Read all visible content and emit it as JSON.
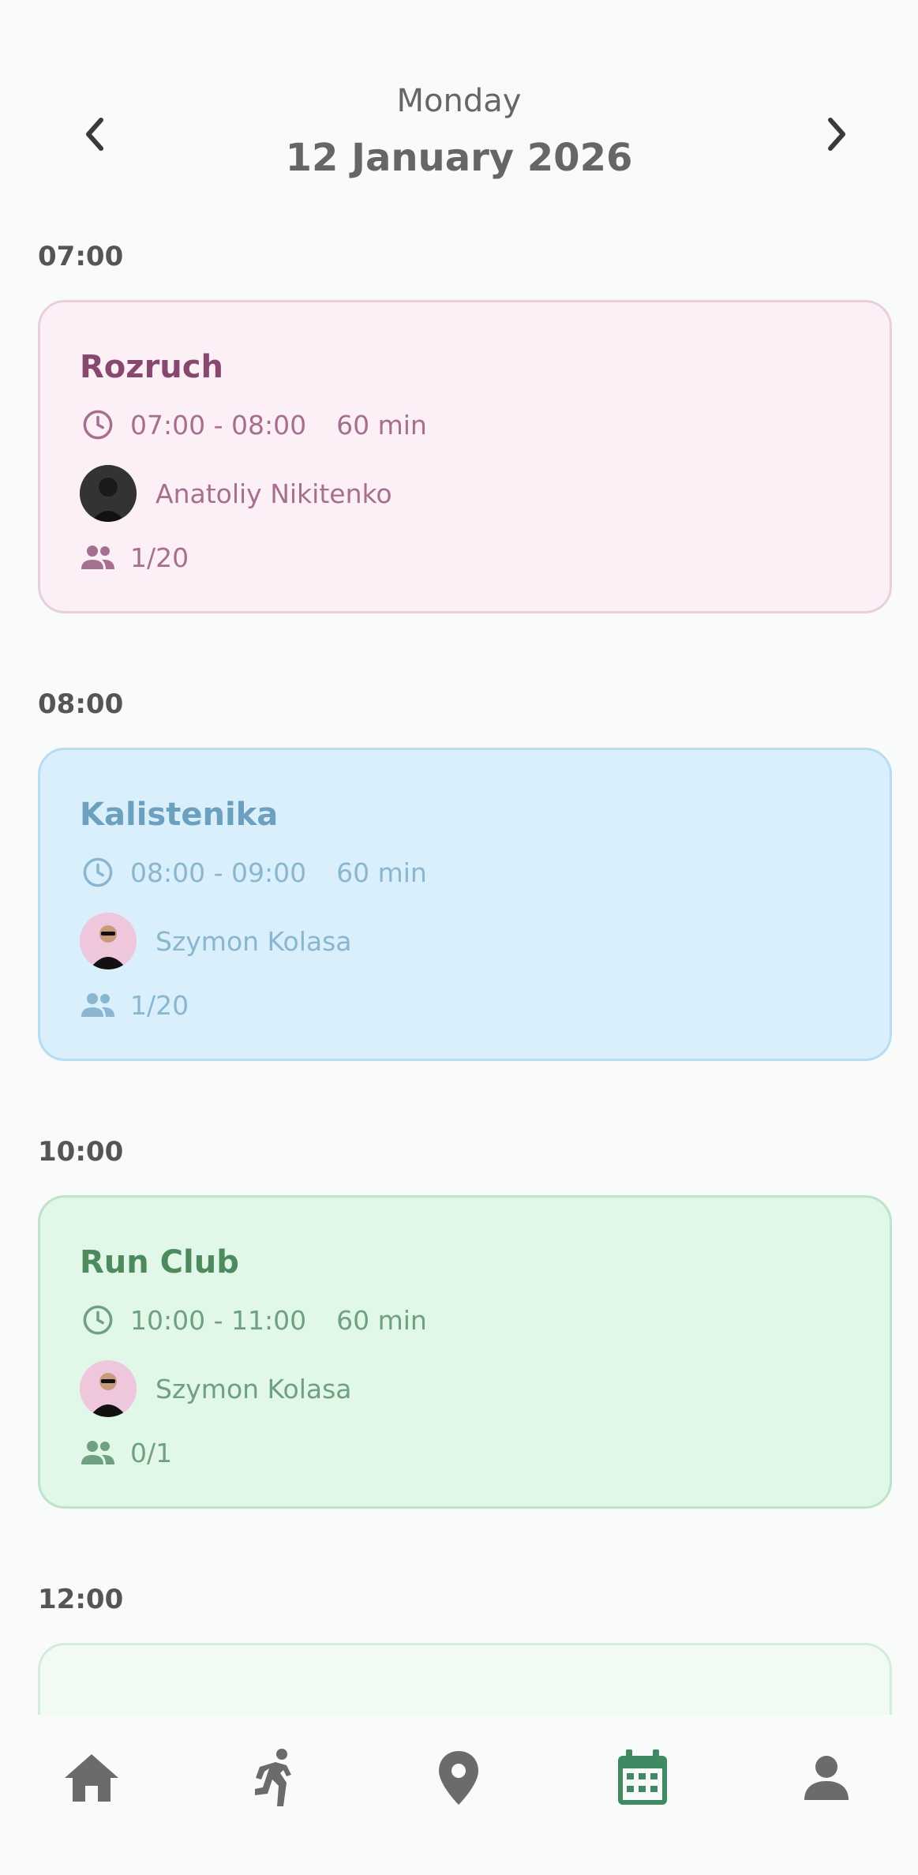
{
  "header": {
    "weekday": "Monday",
    "date": "12 January 2026",
    "prev_icon": "chevron-left-icon",
    "next_icon": "chevron-right-icon"
  },
  "colors": {
    "pink_bg": "#fcf0f6",
    "pink_border": "#e8cfdd",
    "pink_title": "#87486f",
    "pink_text": "#a56f90",
    "blue_bg": "#d9effc",
    "blue_border": "#b8dcf1",
    "blue_title": "#6d9fbe",
    "blue_text": "#8ab6cf",
    "green_bg": "#e1f8e8",
    "green_border": "#bfe3c9",
    "green_title": "#4d8a5e",
    "green_text": "#6fa07f",
    "nav_active": "#3f8a62",
    "nav_inactive": "#6b6b6b"
  },
  "schedule": {
    "slots": [
      {
        "time": "07:00",
        "class": {
          "title": "Rozruch",
          "time_range": "07:00 - 08:00",
          "duration": "60 min",
          "trainer": "Anatoliy Nikitenko",
          "participants": "1/20"
        }
      },
      {
        "time": "08:00",
        "class": {
          "title": "Kalistenika",
          "time_range": "08:00 - 09:00",
          "duration": "60 min",
          "trainer": "Szymon Kolasa",
          "participants": "1/20"
        }
      },
      {
        "time": "10:00",
        "class": {
          "title": "Run Club",
          "time_range": "10:00 - 11:00",
          "duration": "60 min",
          "trainer": "Szymon Kolasa",
          "participants": "0/1"
        }
      },
      {
        "time": "12:00"
      }
    ]
  },
  "bottom_nav": {
    "items": [
      {
        "icon": "home-icon"
      },
      {
        "icon": "running-icon"
      },
      {
        "icon": "location-pin-icon"
      },
      {
        "icon": "calendar-icon",
        "active": true
      },
      {
        "icon": "person-icon"
      }
    ]
  }
}
